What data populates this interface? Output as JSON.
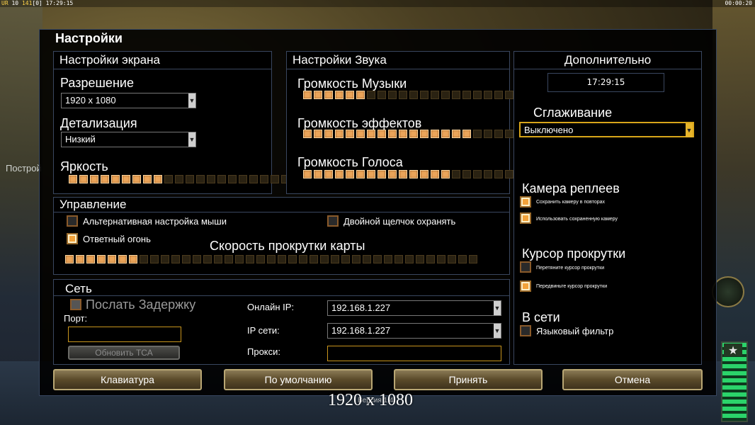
{
  "hud": {
    "left_a": "UR",
    "left_b": "10",
    "left_c": "141",
    "left_d": "[0]",
    "left_time": "17:29:15",
    "right_time": "00:00:20"
  },
  "background": {
    "text": "Построй"
  },
  "dialog": {
    "title": "Настройки",
    "version": "Версия 1.4"
  },
  "screen": {
    "header": "Настройки экрана",
    "resolution_label": "Разрешение",
    "resolution_value": "1920 x 1080",
    "detail_label": "Детализация",
    "detail_value": "Низкий",
    "brightness_label": "Яркость",
    "brightness_level": 9,
    "brightness_total": 22
  },
  "sound": {
    "header": "Настройки Звука",
    "music_label": "Громкость Музыки",
    "music_level": 6,
    "music_total": 20,
    "effects_label": "Громкость эффектов",
    "effects_level": 16,
    "effects_total": 20,
    "voice_label": "Громкость Голоса",
    "voice_level": 14,
    "voice_total": 20
  },
  "extra": {
    "header": "Дополнительно",
    "time_display": "17:29:15",
    "antialias_label": "Сглаживание",
    "antialias_value": "Выключено",
    "replay_camera_label": "Камера реплеев",
    "save_camera": "Сохранить камеру в повторах",
    "use_camera": "Использовать сохраненную камеру",
    "scroll_cursor_label": "Курсор прокрутки",
    "drag_cursor": "Перетяните курсор прокрутки",
    "move_cursor": "Передвиньте курсор прокрутки",
    "online_label": "В сети",
    "language_filter": "Языковый фильтр"
  },
  "controls": {
    "header": "Управление",
    "alt_mouse": "Альтернативная настройка мыши",
    "double_click": "Двойной щелчок охранять",
    "return_fire": "Ответный огонь",
    "scroll_speed_label": "Скорость прокрутки карты",
    "scroll_level": 7,
    "scroll_total": 39
  },
  "network": {
    "header": "Сеть",
    "send_delay": "Послать Задержку",
    "port_label": "Порт:",
    "update_button": "Обновить ТСА",
    "online_ip_label": "Онлайн IP:",
    "online_ip_value": "192.168.1.227",
    "net_ip_label": "IP сети:",
    "net_ip_value": "192.168.1.227",
    "proxy_label": "Прокси:"
  },
  "buttons": {
    "keyboard": "Клавиатура",
    "defaults": "По умолчанию",
    "accept": "Принять",
    "cancel": "Отмена"
  },
  "caption": "1920 x 1080",
  "colors": {
    "accent": "#e7b52b",
    "slider_on": "#eaa45a",
    "panel_border": "#3a4760"
  }
}
